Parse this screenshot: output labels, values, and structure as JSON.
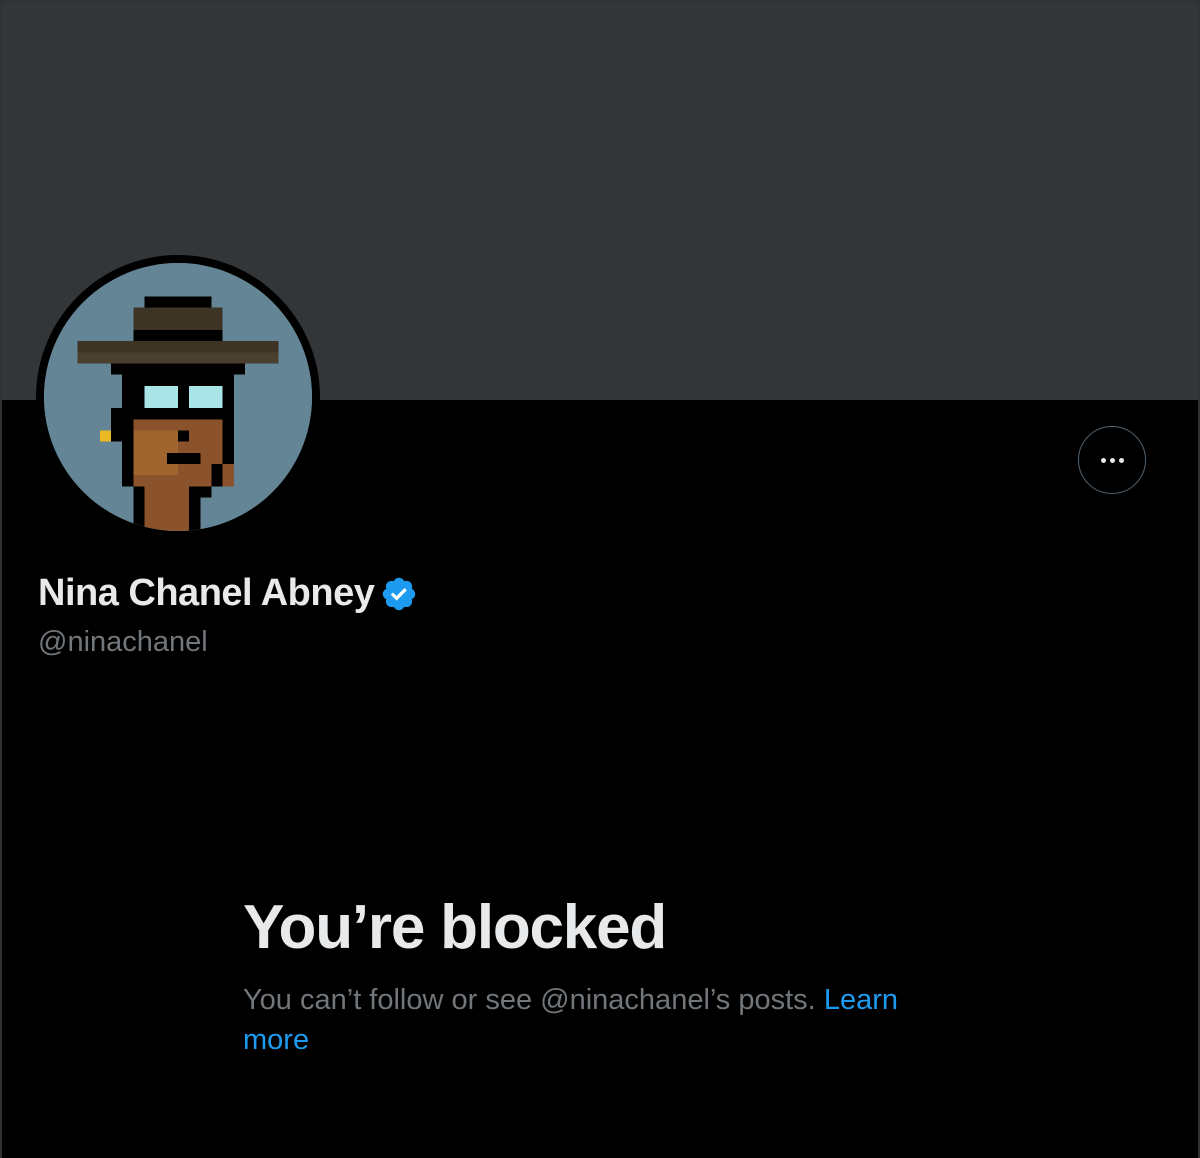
{
  "profile": {
    "display_name": "Nina Chanel Abney",
    "handle": "@ninachanel",
    "verified_icon": "verified-badge-icon",
    "avatar_icon": "pixel-avatar-icon",
    "more_icon": "more-horizontal-icon"
  },
  "blocked": {
    "title": "You’re blocked",
    "message": "You can’t follow or see @ninachanel’s posts.",
    "link_label": "Learn more"
  },
  "colors": {
    "background": "#000000",
    "banner": "#333639",
    "primary_text": "#e7e9ea",
    "secondary_text": "#71767b",
    "link": "#1d9bf0",
    "verified": "#1d9bf0"
  }
}
